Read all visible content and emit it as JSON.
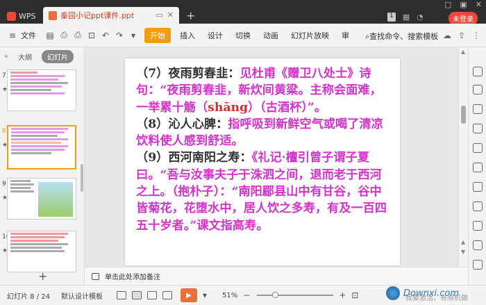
{
  "titlebar": {
    "app_tab": "WPS",
    "doc_tab": "秦园小记ppt课件.ppt",
    "page_badge": "1",
    "login": "未登录"
  },
  "menubar": {
    "file": "文件",
    "tabs": [
      "开始",
      "插入",
      "设计",
      "切换",
      "动画",
      "幻灯片放映",
      "审"
    ],
    "search_placeholder": "查找命令、搜索模板"
  },
  "left_panel": {
    "tabs": [
      "大纲",
      "幻灯片"
    ],
    "active_tab": "幻灯片",
    "slides": [
      {
        "num": "7"
      },
      {
        "num": "8",
        "selected": true
      },
      {
        "num": "9"
      },
      {
        "num": "10"
      }
    ]
  },
  "slide": {
    "p1_a": "（7）夜雨剪春韭：",
    "p1_b": "见杜甫《赠卫八处士》诗句：“夜雨剪春韭，新炊间黄粱。主称会面难，一举累十觞（",
    "p1_pinyin": "shāng",
    "p1_c": "）（古酒杯）”。",
    "p2_a": "（8）沁人心脾：",
    "p2_b": "指呼吸到新鲜空气或喝了清凉饮料使人感到舒适。",
    "p3_a": "（9）西河南阳之寿：",
    "p3_b": "《礼记·檀引曾子谓子夏曰。“吾与汝事夫子于洙泗之间，退而老于西河之上。（抱朴子）：“南阳郿县山中有甘谷，谷中皆菊花，花堕水中，居人饮之多寿，有及一百四五十岁者。”课文指高寿。"
  },
  "notes": {
    "placeholder": "单击此处添加备注"
  },
  "statusbar": {
    "slide_info": "幻灯片 8 / 24",
    "template": "默认设计模板",
    "zoom": "51%",
    "zoom_fraction": 0.51
  },
  "watermark": {
    "text": "Downxi.com",
    "subtext": "我要激活，有限机做"
  },
  "colors": {
    "accent": "#f39c12",
    "slide_magenta": "#d633cc",
    "slide_red": "#d12f2f",
    "login_red": "#e84a3c"
  }
}
